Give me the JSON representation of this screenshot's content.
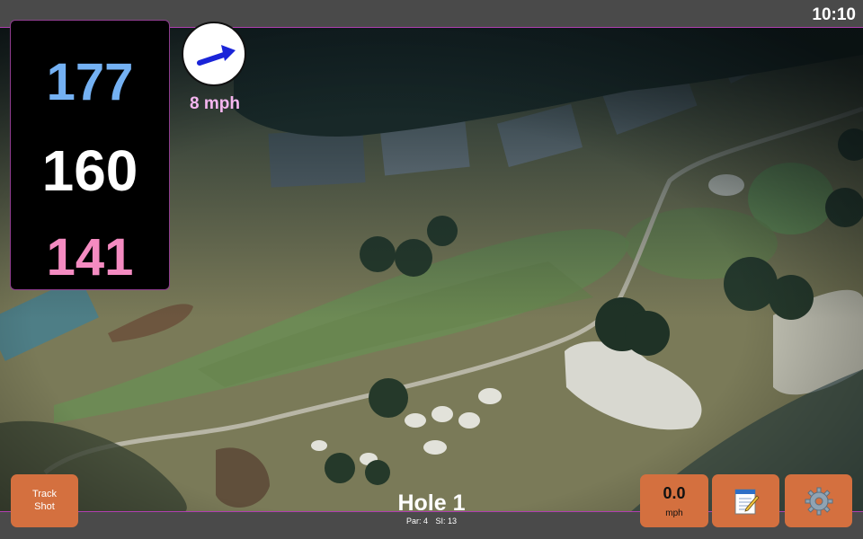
{
  "status": {
    "clock": "10:10"
  },
  "distances": {
    "back": "177",
    "middle": "160",
    "front": "141"
  },
  "wind": {
    "speed": "8 mph",
    "icon": "arrow-right-up-icon"
  },
  "buttons": {
    "track_shot_line1": "Track",
    "track_shot_line2": "Shot",
    "speed_value": "0.0",
    "speed_unit": "mph",
    "notes_icon": "notepad-icon",
    "settings_icon": "gear-icon"
  },
  "hole": {
    "title": "Hole 1",
    "par": "Par: 4",
    "si": "SI: 13"
  },
  "colors": {
    "back_distance": "#74b1f3",
    "middle_distance": "#ffffff",
    "front_distance": "#f48bc1",
    "wind_text": "#f6b6f0",
    "button": "#d4703f",
    "accent_border": "#b03fb0"
  }
}
